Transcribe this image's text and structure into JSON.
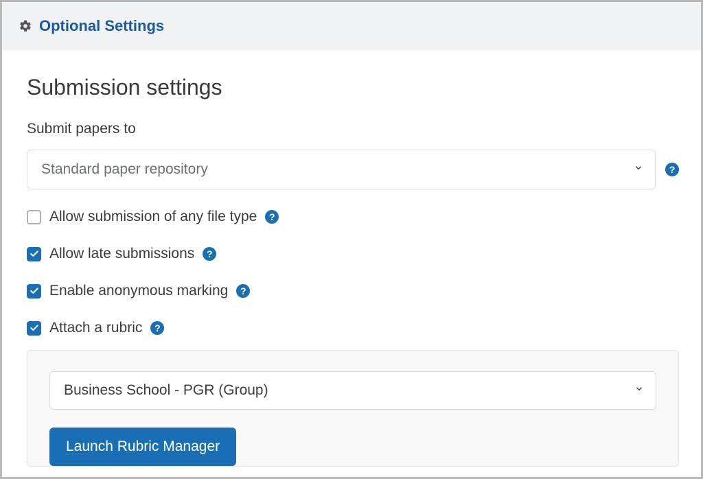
{
  "header": {
    "title": "Optional Settings"
  },
  "section": {
    "title": "Submission settings"
  },
  "submitTo": {
    "label": "Submit papers to",
    "selected": "Standard paper repository"
  },
  "options": {
    "anyFileType": {
      "label": "Allow submission of any file type",
      "checked": false
    },
    "lateSubmissions": {
      "label": "Allow late submissions",
      "checked": true
    },
    "anonymousMarking": {
      "label": "Enable anonymous marking",
      "checked": true
    },
    "attachRubric": {
      "label": "Attach a rubric",
      "checked": true
    }
  },
  "rubric": {
    "selected": "Business School - PGR (Group)",
    "launchButton": "Launch Rubric Manager"
  },
  "icons": {
    "help": "?"
  }
}
